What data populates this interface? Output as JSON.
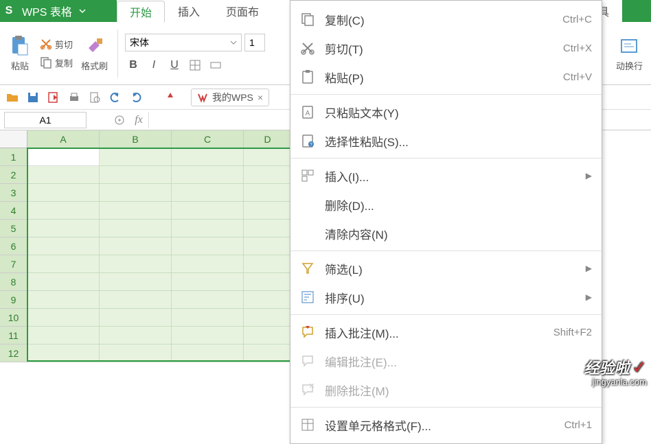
{
  "titlebar": {
    "app_name": "WPS 表格"
  },
  "menubar": {
    "tabs": [
      {
        "label": "开始",
        "active": true
      },
      {
        "label": "插入"
      },
      {
        "label": "页面布"
      },
      {
        "label": "工具"
      }
    ]
  },
  "ribbon": {
    "paste": "粘贴",
    "cut": "剪切",
    "copy": "复制",
    "format_painter": "格式刷",
    "font_name": "宋体",
    "wrap_text": "动换行"
  },
  "qat": {
    "doc_tab": "我的WPS"
  },
  "formulabar": {
    "cell_ref": "A1"
  },
  "sheet": {
    "cols": [
      "A",
      "B",
      "C",
      "D"
    ],
    "rows": [
      "1",
      "2",
      "3",
      "4",
      "5",
      "6",
      "7",
      "8",
      "9",
      "10",
      "11",
      "12"
    ],
    "selected_cols": 4,
    "selected_rows": 12
  },
  "context_menu": {
    "items": [
      {
        "icon": "copy",
        "label": "复制(C)",
        "shortcut": "Ctrl+C"
      },
      {
        "icon": "cut",
        "label": "剪切(T)",
        "shortcut": "Ctrl+X"
      },
      {
        "icon": "paste",
        "label": "粘贴(P)",
        "shortcut": "Ctrl+V"
      },
      {
        "sep": true
      },
      {
        "icon": "paste-text",
        "label": "只粘贴文本(Y)"
      },
      {
        "icon": "paste-special",
        "label": "选择性粘贴(S)..."
      },
      {
        "sep": true
      },
      {
        "icon": "insert",
        "label": "插入(I)...",
        "submenu": true
      },
      {
        "label": "删除(D)..."
      },
      {
        "label": "清除内容(N)"
      },
      {
        "sep": true
      },
      {
        "icon": "filter",
        "label": "筛选(L)",
        "submenu": true
      },
      {
        "icon": "sort",
        "label": "排序(U)",
        "submenu": true
      },
      {
        "sep": true
      },
      {
        "icon": "comment",
        "label": "插入批注(M)...",
        "shortcut": "Shift+F2"
      },
      {
        "icon": "edit-comment",
        "label": "编辑批注(E)...",
        "disabled": true
      },
      {
        "icon": "delete-comment",
        "label": "删除批注(M)",
        "disabled": true
      },
      {
        "sep": true
      },
      {
        "icon": "format-cells",
        "label": "设置单元格格式(F)...",
        "shortcut": "Ctrl+1"
      }
    ]
  },
  "watermark": {
    "line1": "经验啦",
    "line2": "jingyanla.com"
  }
}
